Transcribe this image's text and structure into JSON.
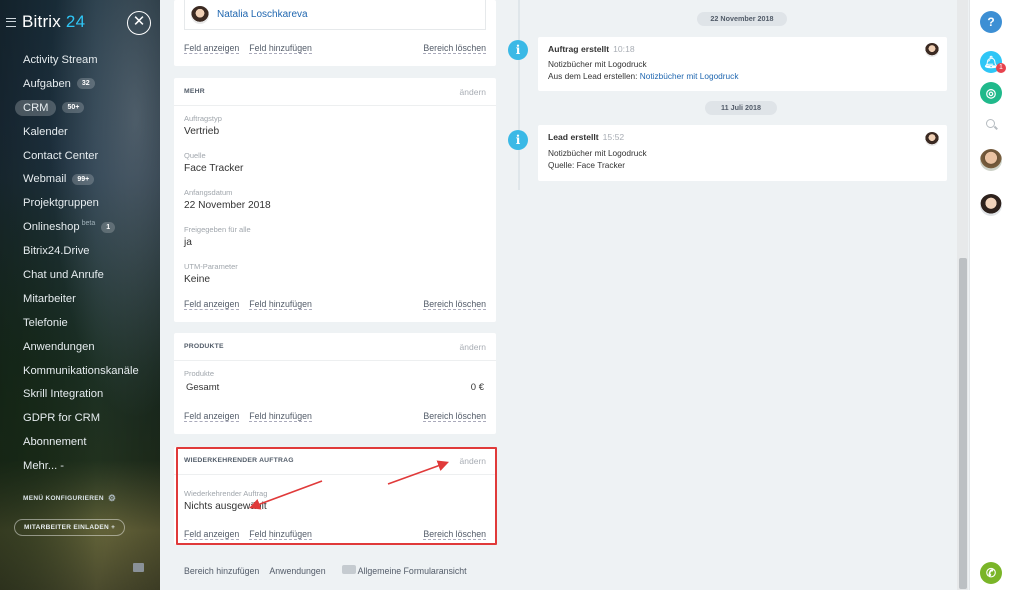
{
  "sidebar": {
    "logo_text": "Bitrix",
    "logo_num": "24",
    "close_glyph": "✕",
    "items": [
      {
        "label": "Activity Stream"
      },
      {
        "label": "Aufgaben",
        "count": "32"
      },
      {
        "label": "CRM",
        "count": "50+",
        "active": true
      },
      {
        "label": "Kalender"
      },
      {
        "label": "Contact Center"
      },
      {
        "label": "Webmail",
        "count": "99+"
      },
      {
        "label": "Projektgruppen"
      },
      {
        "label": "Onlineshop",
        "beta": "beta",
        "count": "1"
      },
      {
        "label": "Bitrix24.Drive"
      },
      {
        "label": "Chat und Anrufe"
      },
      {
        "label": "Mitarbeiter"
      },
      {
        "label": "Telefonie"
      },
      {
        "label": "Anwendungen"
      },
      {
        "label": "Kommunikationskanäle"
      },
      {
        "label": "Skrill Integration"
      },
      {
        "label": "GDPR for CRM"
      },
      {
        "label": "Abonnement"
      },
      {
        "label": "Mehr... -"
      }
    ],
    "configure": "MENÜ KONFIGURIEREN",
    "invite": "MITARBEITER EINLADEN"
  },
  "cards": {
    "top": {
      "person": "Natalia Loschkareva",
      "show_field": "Feld anzeigen",
      "add_field": "Feld hinzufügen",
      "delete": "Bereich löschen"
    },
    "mehr": {
      "title": "MEHR",
      "change": "ändern",
      "fields": [
        {
          "label": "Auftragstyp",
          "value": "Vertrieb"
        },
        {
          "label": "Quelle",
          "value": "Face Tracker"
        },
        {
          "label": "Anfangsdatum",
          "value": "22 November 2018"
        },
        {
          "label": "Freigegeben für alle",
          "value": "ja"
        },
        {
          "label": "UTM-Parameter",
          "value": "Keine"
        }
      ],
      "show_field": "Feld anzeigen",
      "add_field": "Feld hinzufügen",
      "delete": "Bereich löschen"
    },
    "produkte": {
      "title": "PRODUKTE",
      "change": "ändern",
      "label": "Produkte",
      "total_label": "Gesamt",
      "total_value": "0 €",
      "show_field": "Feld anzeigen",
      "add_field": "Feld hinzufügen",
      "delete": "Bereich löschen"
    },
    "recurring": {
      "title": "WIEDERKEHRENDER AUFTRAG",
      "change": "ändern",
      "label": "Wiederkehrender Auftrag",
      "value": "Nichts ausgewählt",
      "show_field": "Feld anzeigen",
      "add_field": "Feld hinzufügen",
      "delete": "Bereich löschen"
    }
  },
  "bottom": {
    "add_section": "Bereich hinzufügen",
    "apps": "Anwendungen",
    "general_form": "Allgemeine Formularansicht"
  },
  "timeline": {
    "dates": [
      "22 November 2018",
      "11 Juli 2018"
    ],
    "events": [
      {
        "title": "Auftrag erstellt",
        "time": "10:18",
        "line1": "Notizbücher mit Logodruck",
        "line2_prefix": "Aus dem Lead erstellen: ",
        "line2_link": "Notizbücher mit Logodruck"
      },
      {
        "title": "Lead erstellt",
        "time": "15:52",
        "line1": "Notizbücher mit Logodruck",
        "line2": "Quelle: Face Tracker"
      }
    ]
  },
  "right_panel": {
    "help": "?",
    "notification_count": "1"
  },
  "colors": {
    "accent": "#2fc6f6",
    "info": "#3ab9e6",
    "highlight": "#e03a3a",
    "link": "#2067b0",
    "call": "#7ab528"
  }
}
